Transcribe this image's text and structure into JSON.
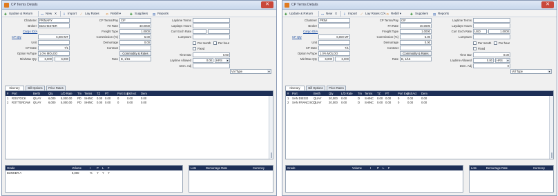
{
  "windows": [
    {
      "title": "CP Terms Details",
      "toolbar": {
        "save": "Update & Return",
        "new": "New",
        "delete": "X",
        "import": "Import",
        "laytime": "Lay Rates",
        "rebill": "Rebill",
        "suppliers": "Suppliers",
        "reports": "Reports"
      },
      "form": {
        "charterer_label": "Charterer",
        "charterer": "PRIMARY",
        "broker_label": "Broker",
        "broker": "EDCHESTER",
        "cargo_label": "Cargo",
        "cargo_link": "Cargo ID/A",
        "cp_qty_label": "CP Qty",
        "cp_qty": "6,000 MT",
        "unit_label": "Unit",
        "unit": "",
        "cp_date_label": "CP Date",
        "cp_date": "7/1",
        "option_label": "Option %/Type",
        "option": "1.0% MOLOO",
        "min_max_label": "Min/Max Qty",
        "min_qty": "6,000",
        "max_qty": "6,000",
        "cp_terms_label": "CP Terms/Pay",
        "cp_terms": "CIF",
        "frt_rate_label": "Frt Rate",
        "frt_rate": "40.0000",
        "frt_type_label": "Freight Type",
        "frt_type": "1.0000",
        "commission_label": "Commission (%)",
        "commission": "5.00",
        "demurrage_label": "Demurrage",
        "demurrage": "0.00",
        "contract_label": "Contract",
        "contract": "",
        "tax_label": "Tax Type",
        "tax": "",
        "rate_label": "Rate",
        "rate": "B, 1/15",
        "laytime_label": "Laytime Terms",
        "laytime": "",
        "layhours_label": "Laydays Hours",
        "layhours": "",
        "layhours_currency_label": "Currency",
        "layhours_currency": "",
        "curr_exch_label": "Curr Exch Rate",
        "curr": "",
        "exch_rate": "",
        "lumpsum_label": "Lumpsum",
        "lumpsum": "",
        "dem_fixed_label": "Dem. Fixed",
        "dem_fixed_chk": "Fixed",
        "dem_rate_label": "Dem. Rate",
        "dem_rate": "",
        "dem_rate_val": "0.00",
        "dem_type_label": "Dem. Type",
        "dem_type": "",
        "dem_time_label": "Dem. Time",
        "dem_time": "",
        "dem_adj_label": "Dem. Adj",
        "dem_adj": "",
        "dem_rate2": "0.00",
        "vol_label": "Vol Type",
        "vol": "",
        "commodity_btn": "Commodity & Rates",
        "per_month": "Per month",
        "per_hour": "Per hour",
        "time_bar_label": "Time Bar",
        "time_bar": "",
        "demurrage_amount": "",
        "laytime_allowed_label": "Laytime Allowed",
        "laytime_allowed": "0.00",
        "laytime_unit": "HRS"
      },
      "tabs": [
        {
          "label": "Itinerary"
        },
        {
          "label": "Bill Options"
        },
        {
          "label": "Price Rates"
        }
      ],
      "grid": {
        "headers": [
          "#",
          "Port",
          "Berth",
          "Qty",
          "L/D Rate",
          "Tm",
          "Terms",
          "TZ",
          "PT",
          "Port Exp",
          "Est/Act",
          "Dem"
        ],
        "rows": [
          [
            "1",
            "ROSTOCK",
            "QUAY",
            "6,000",
            "5,000.00",
            "PD",
            "SHINC",
            "0.00",
            "0.00",
            "0",
            "0.00",
            "0.00"
          ],
          [
            "2",
            "ROTTERDAM",
            "QUAY",
            "6,000",
            "5,000.00",
            "PD",
            "SHINC",
            "0.00",
            "0.00",
            "0",
            "0.00",
            "0.00"
          ]
        ]
      },
      "sub_left": {
        "headers": [
          "Grade",
          "Volume",
          "I",
          "P",
          "L",
          "F"
        ],
        "rows": [
          [
            "BUNKER A",
            "6,000",
            "%",
            "Y",
            "Y",
            "Y"
          ]
        ]
      },
      "sub_right": {
        "headers": [
          "Lots",
          "Demurrage Rate",
          "Currency"
        ],
        "rows": []
      }
    },
    {
      "title": "CP Terms Details",
      "toolbar": {
        "save": "Update & Return",
        "new": "New",
        "delete": "X",
        "import": "Import",
        "laytime": "Lay Rates C/A",
        "rebill": "Rebill",
        "suppliers": "Suppliers",
        "reports": "Reports"
      },
      "form": {
        "charterer_label": "Charterer",
        "charterer": "PRIM",
        "broker_label": "Broker",
        "broker": "",
        "cargo_label": "Cargo",
        "cargo_link": "Cargo ID/A",
        "cp_qty_label": "CP Qty",
        "cp_qty": "6,000 MT",
        "unit_label": "Unit",
        "unit": "",
        "cp_date_label": "CP Date",
        "cp_date": "7/1",
        "option_label": "Option %/Type",
        "option": "1.0% MOLOO",
        "min_max_label": "Min/Max Qty",
        "min_qty": "6,000",
        "max_qty": "6,000",
        "cp_terms_label": "CP Terms/Pay",
        "cp_terms": "CIF",
        "frt_rate_label": "Frt Rate",
        "frt_rate": "40.0000",
        "frt_type_label": "Freight Type",
        "frt_type": "1.0000",
        "commission_label": "Commission (%)",
        "commission": "5.00",
        "demurrage_label": "Demurrage",
        "demurrage": "0.00",
        "contract_label": "Contract",
        "contract": "",
        "tax_label": "Tax Type",
        "tax": "",
        "rate_label": "Rate",
        "rate": "B, 1/15",
        "laytime_label": "Laytime Terms",
        "laytime": "",
        "layhours_label": "Laydays Hours",
        "layhours": "",
        "layhours_currency_label": "Currency",
        "layhours_currency": "",
        "curr_exch_label": "Curr Exch Rate",
        "curr": "USD",
        "exch_rate": "1.0000",
        "lumpsum_label": "Lumpsum",
        "lumpsum": "",
        "dem_fixed_label": "Dem. Fixed",
        "dem_fixed_chk": "Fixed",
        "dem_rate_label": "Dem. Rate",
        "dem_rate": "",
        "dem_rate_val": "0.00",
        "dem_type_label": "Dem. Type",
        "dem_type": "",
        "dem_time_label": "Dem. Time",
        "dem_time": "",
        "dem_adj_label": "Dem. Adj",
        "dem_adj": "",
        "dem_rate2": "0.00",
        "vol_label": "Vol Type",
        "vol": "",
        "commodity_btn": "Commodity & Rates",
        "per_month": "Per month",
        "per_hour": "Per hour",
        "time_bar_label": "Time Bar",
        "time_bar": "",
        "demurrage_amount": "0",
        "laytime_allowed_label": "Laytime Allowed",
        "laytime_allowed": "0.00",
        "laytime_unit": "HRS"
      },
      "tabs": [
        {
          "label": "Itinerary"
        },
        {
          "label": "Bill Options"
        },
        {
          "label": "Price Rates"
        }
      ],
      "grid": {
        "headers": [
          "#",
          "Port",
          "Berth",
          "Qty",
          "L/D Rate",
          "Tm",
          "Terms",
          "TZ",
          "PT",
          "Port Exp",
          "Est/Act",
          "Dem"
        ],
        "rows": [
          [
            "1",
            "SAN DIEGO",
            "QUAY",
            "20,000",
            "0.00",
            "D",
            "SHINC",
            "0.00",
            "0.00",
            "0",
            "0.00",
            "0.00"
          ],
          [
            "2",
            "SAN FRANCISCO",
            "QUAY",
            "20,000",
            "0.00",
            "D",
            "SHINC",
            "0.00",
            "0.00",
            "0",
            "0.00",
            "0.00"
          ]
        ]
      },
      "sub_left": {
        "headers": [
          "Grade",
          "Volume",
          "I",
          "P",
          "L",
          "F"
        ],
        "rows": []
      },
      "sub_right": {
        "headers": [
          "Lots",
          "Demurrage Rate",
          "Currency"
        ],
        "rows": []
      }
    }
  ],
  "colors": {
    "grid_header": "#1d2f57",
    "titlebar": "#c9d8ec",
    "close": "#c9483b",
    "link": "#1f4fa0"
  },
  "icons": [
    "app-icon",
    "close-icon",
    "save-icon",
    "new-icon",
    "delete-icon",
    "import-icon",
    "laytime-icon",
    "rebill-icon",
    "suppliers-icon",
    "reports-icon"
  ]
}
